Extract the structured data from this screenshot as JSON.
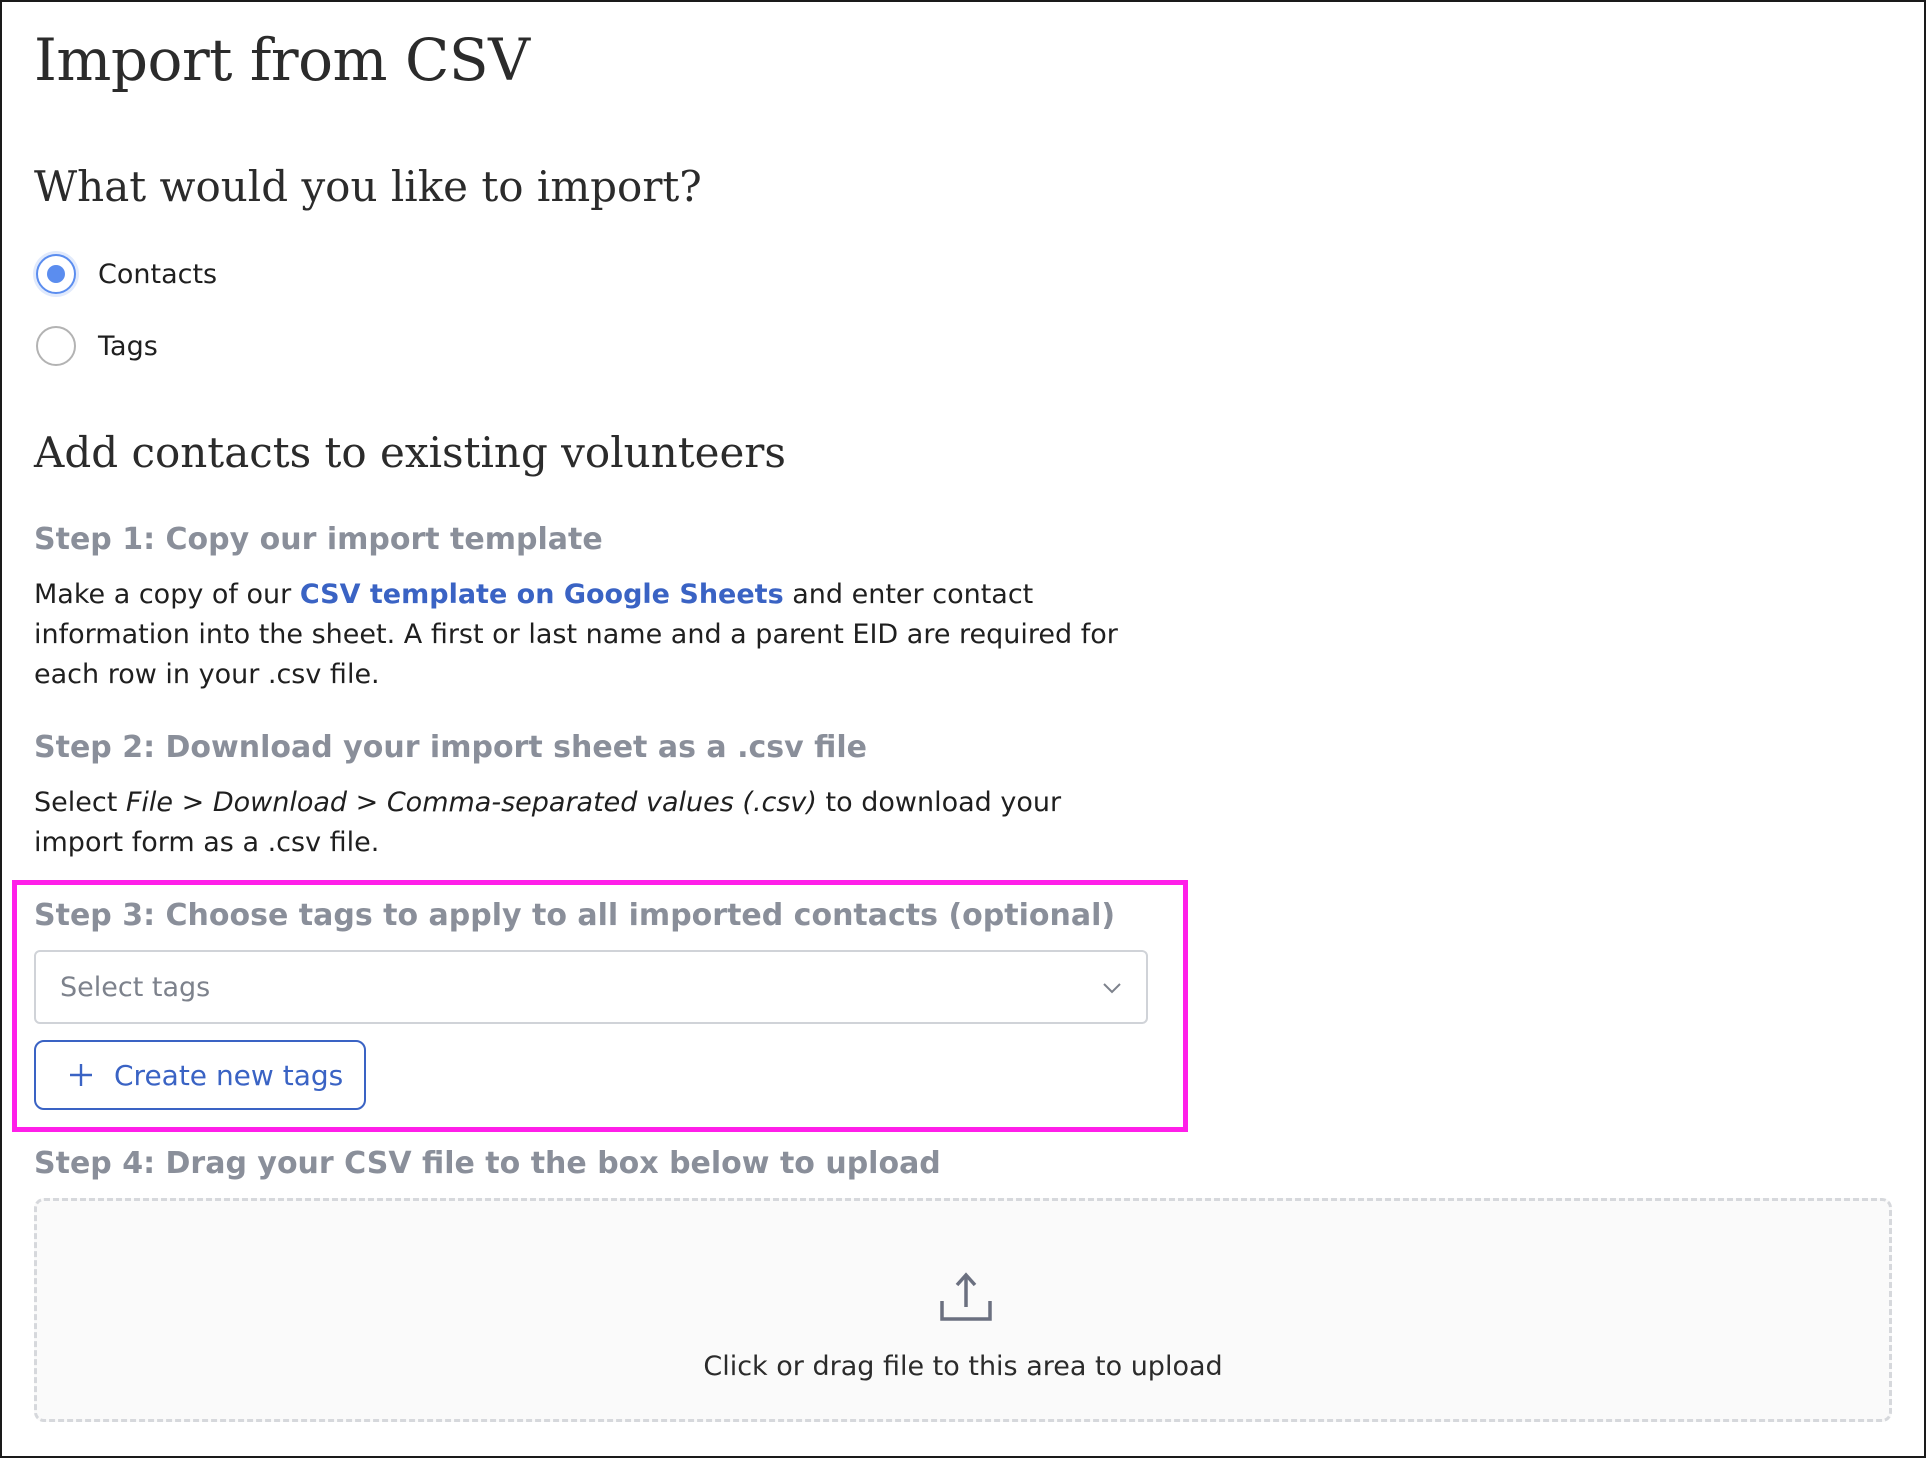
{
  "page": {
    "title": "Import from CSV"
  },
  "import_type": {
    "question": "What would you like to import?",
    "options": [
      {
        "label": "Contacts",
        "selected": true
      },
      {
        "label": "Tags",
        "selected": false
      }
    ]
  },
  "section": {
    "title": "Add contacts to existing volunteers"
  },
  "step1": {
    "title": "Step 1: Copy our import template",
    "text_before_link": "Make a copy of our ",
    "link_text": "CSV template on Google Sheets",
    "text_after_link": " and enter contact information into the sheet. A first or last name and a parent EID are required for each row in your .csv file."
  },
  "step2": {
    "title": "Step 2: Download your import sheet as a .csv file",
    "text_before_path": "Select ",
    "path_text": "File > Download > Comma-separated values (.csv)",
    "text_after_path": " to download your import form as a .csv file."
  },
  "step3": {
    "title": "Step 3: Choose tags to apply to all imported contacts (optional)",
    "select_placeholder": "Select tags",
    "create_button_label": "Create new tags"
  },
  "step4": {
    "title": "Step 4: Drag your CSV file to the box below to upload",
    "dropzone_text": "Click or drag file to this area to upload"
  },
  "icons": {
    "radio": "radio-button",
    "dropdown": "chevron-down-icon",
    "create": "plus-icon",
    "upload": "upload-icon"
  },
  "colors": {
    "accent": "#3a63c4",
    "radio_selected": "#5b8def",
    "step_heading": "#8a8f9a",
    "highlight": "#ff1fe9"
  }
}
